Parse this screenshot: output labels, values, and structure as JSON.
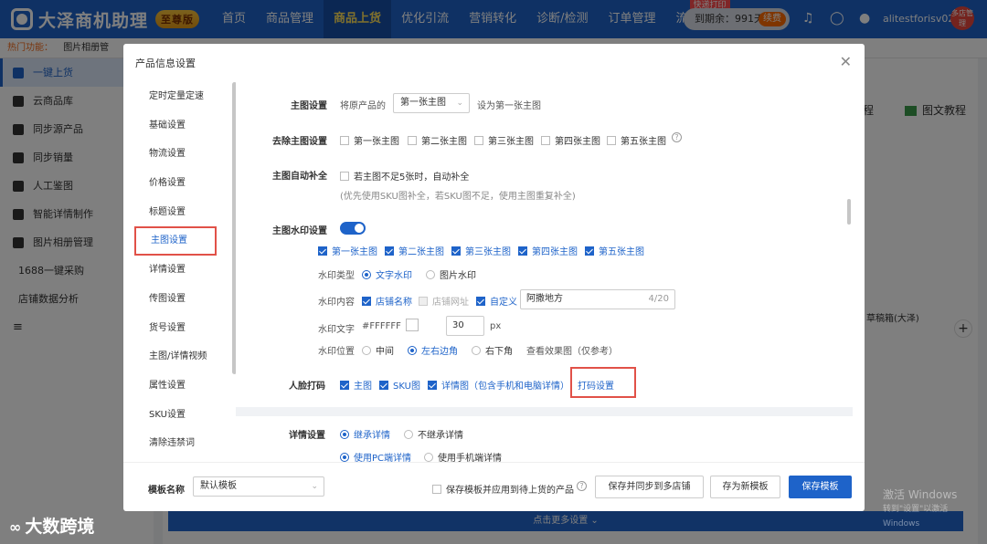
{
  "app": {
    "logo_text": "大泽商机助理",
    "vip_badge": "至尊版",
    "nav": [
      "首页",
      "商品管理",
      "商品上货",
      "优化引流",
      "营销转化",
      "诊断/检测",
      "订单管理",
      "流量推广"
    ],
    "nav_flag": "快递打印",
    "expire_text": "到期余：991天",
    "renew_label": "续费",
    "account": "alitestforisv02",
    "avatar_text": "多店管理"
  },
  "subbar": {
    "hot_label": "热门功能：",
    "item": "图片相册管"
  },
  "sidebar": {
    "items": [
      "一键上货",
      "云商品库",
      "同步源产品",
      "同步销量",
      "人工鉴图",
      "智能详情制作",
      "图片相册管理",
      "1688一键采购",
      "店铺数据分析"
    ]
  },
  "background": {
    "process_fragment": "程",
    "tutorial": "图文教程",
    "sample_text": "草稿箱(大泽)",
    "bottom_btn": "点击更多设置 ⌄"
  },
  "modal": {
    "title": "产品信息设置",
    "side_items": [
      "定时定量定速",
      "基础设置",
      "物流设置",
      "价格设置",
      "标题设置",
      "主图设置",
      "详情设置",
      "传图设置",
      "货号设置",
      "主图/详情视频",
      "属性设置",
      "SKU设置",
      "清除违禁词"
    ],
    "main_image": {
      "label": "主图设置",
      "prefix": "将原产品的",
      "selected": "第一张主图",
      "suffix": "设为第一张主图"
    },
    "remove_main": {
      "label": "去除主图设置",
      "options": [
        "第一张主图",
        "第二张主图",
        "第三张主图",
        "第四张主图",
        "第五张主图"
      ]
    },
    "auto_fill": {
      "label": "主图自动补全",
      "option": "若主图不足5张时，自动补全",
      "note": "(优先使用SKU图补全，若SKU图不足，使用主图重复补全)"
    },
    "watermark": {
      "label": "主图水印设置",
      "enabled": true,
      "images": [
        "第一张主图",
        "第二张主图",
        "第三张主图",
        "第四张主图",
        "第五张主图"
      ],
      "type_label": "水印类型",
      "type_options": [
        "文字水印",
        "图片水印"
      ],
      "content_label": "水印内容",
      "content_options": [
        "店铺名称",
        "店铺网址",
        "自定义"
      ],
      "custom_text": "阿撒地方",
      "counter": "4/20",
      "text_label": "水印文字",
      "color_hex": "#FFFFFF",
      "font_size": "30",
      "font_unit": "px",
      "position_label": "水印位置",
      "position_options": [
        "中间",
        "左右边角",
        "右下角"
      ],
      "preview_link": "查看效果图（仅参考）"
    },
    "face_code": {
      "label": "人脸打码",
      "options": [
        "主图",
        "SKU图",
        "详情图（包含手机和电脑详情）"
      ],
      "settings_link": "打码设置"
    },
    "detail": {
      "label": "详情设置",
      "row1": [
        "继承详情",
        "不继承详情"
      ],
      "row2": [
        "使用PC端详情",
        "使用手机端详情"
      ]
    },
    "footer": {
      "template_label": "模板名称",
      "template_value": "默认模板",
      "apply_checkbox": "保存模板并应用到待上货的产品",
      "btn_sync": "保存并同步到多店铺",
      "btn_new": "存为新模板",
      "btn_save": "保存模板"
    }
  },
  "watermarks": {
    "brand": "大数跨境",
    "windows_line1": "激活 Windows",
    "windows_line2": "转到\"设置\"以激活 Windows"
  },
  "colors": {
    "primary": "#1e63c9",
    "highlight_border": "#e15148",
    "nav_active_text": "#ffe05a"
  }
}
